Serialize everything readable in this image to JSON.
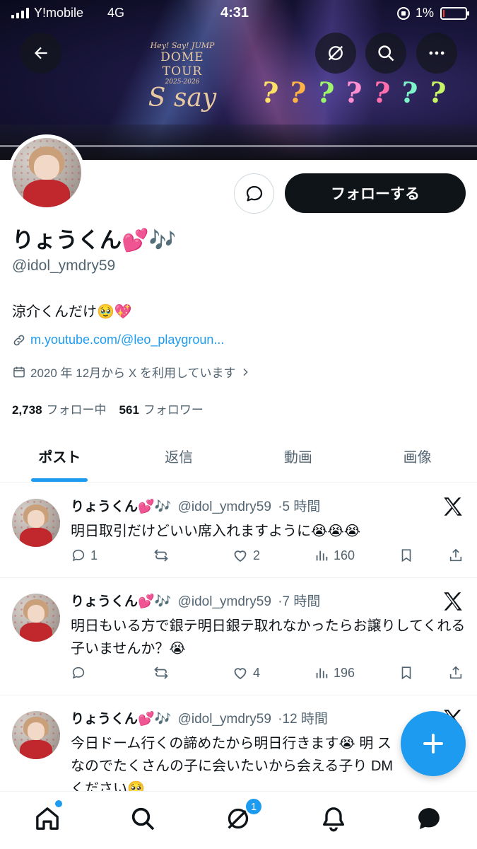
{
  "status_bar": {
    "carrier": "Y!mobile",
    "network": "4G",
    "time": "4:31",
    "battery_percent": "1%"
  },
  "banner": {
    "logo_line1": "Hey! Say! JUMP",
    "logo_line2": "DOME TOUR",
    "logo_line3": "2025-2026",
    "logo_line4": "S say",
    "decor_marks": [
      "?",
      "?",
      "?",
      "?",
      "?",
      "?",
      "?"
    ],
    "buttons": [
      "back-arrow-icon",
      "grok-icon",
      "search-icon",
      "more-icon"
    ]
  },
  "profile": {
    "display_name": "りょうくん💕🎶",
    "handle": "@idol_ymdry59",
    "bio": "涼介くんだけ🥹💖",
    "link": "m.youtube.com/@leo_playgroun...",
    "joined": "2020 年 12月から X を利用しています",
    "following_count": "2,738",
    "following_label": "フォロー中",
    "followers_count": "561",
    "followers_label": "フォロワー",
    "follow_button": "フォローする"
  },
  "tabs": [
    {
      "label": "ポスト",
      "active": true
    },
    {
      "label": "返信",
      "active": false
    },
    {
      "label": "動画",
      "active": false
    },
    {
      "label": "画像",
      "active": false
    }
  ],
  "posts": [
    {
      "name": "りょうくん💕🎶",
      "handle": "@idol_ymdry59",
      "time": "5 時間",
      "text": "明日取引だけどいい席入れますように😭😭😭",
      "replies": "1",
      "retweets": "",
      "likes": "2",
      "views": "160"
    },
    {
      "name": "りょうくん💕🎶",
      "handle": "@idol_ymdry59",
      "time": "7 時間",
      "text": "明日もいる方で銀テ明日銀テ取れなかったらお譲りしてくれる子いませんか？😭",
      "replies": "",
      "retweets": "",
      "likes": "4",
      "views": "196"
    },
    {
      "name": "りょうくん💕🎶",
      "handle": "@idol_ymdry59",
      "time": "12 時間",
      "text": "今日ドーム行くの諦めたから明日行きます😭 明 スなのでたくさんの子に会いたいから会える子り DMください🥺",
      "replies": "",
      "retweets": "",
      "likes": "",
      "views": ""
    }
  ],
  "bottom_nav": {
    "items": [
      "home-icon",
      "search-icon",
      "grok-icon",
      "notifications-icon",
      "messages-icon"
    ],
    "badge": "1"
  },
  "colors": {
    "accent": "#1d9bf0",
    "text": "#0f1419",
    "secondary": "#536471",
    "follow_button_bg": "#0f1419"
  }
}
